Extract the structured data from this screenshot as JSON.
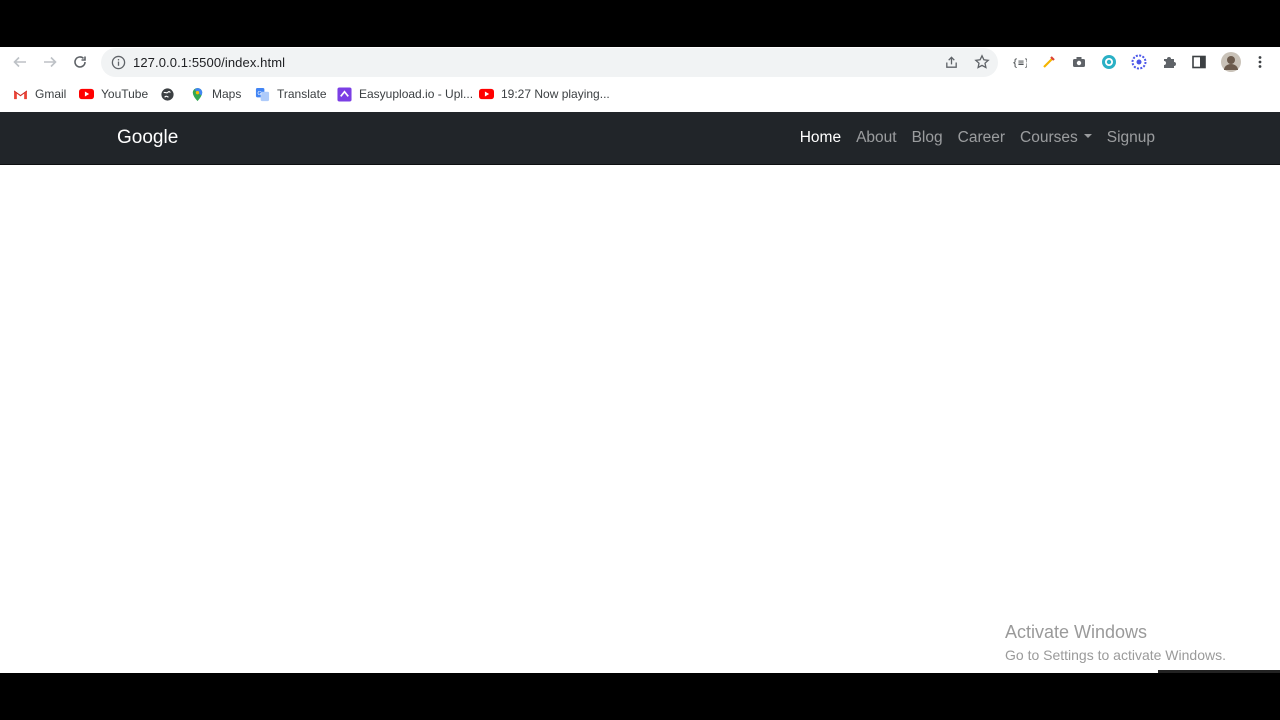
{
  "browser": {
    "url": "127.0.0.1:5500/index.html"
  },
  "bookmarks": [
    {
      "label": "Gmail",
      "icon": "gmail-icon"
    },
    {
      "label": "YouTube",
      "icon": "youtube-icon"
    },
    {
      "label": "",
      "icon": "globe-icon"
    },
    {
      "label": "Maps",
      "icon": "maps-icon"
    },
    {
      "label": "Translate",
      "icon": "translate-icon"
    },
    {
      "label": "Easyupload.io - Upl...",
      "icon": "easyupload-icon"
    },
    {
      "label": "19:27 Now playing...",
      "icon": "youtube-icon"
    }
  ],
  "navbar": {
    "brand": "Google",
    "links": [
      "Home",
      "About",
      "Blog",
      "Career",
      "Courses",
      "Signup"
    ],
    "active": "Home"
  },
  "watermark": {
    "title": "Activate Windows",
    "subtitle": "Go to Settings to activate Windows."
  },
  "colors": {
    "navbar_bg": "#212529",
    "youtube_red": "#ff0000",
    "ext_blue": "#4285f4"
  }
}
